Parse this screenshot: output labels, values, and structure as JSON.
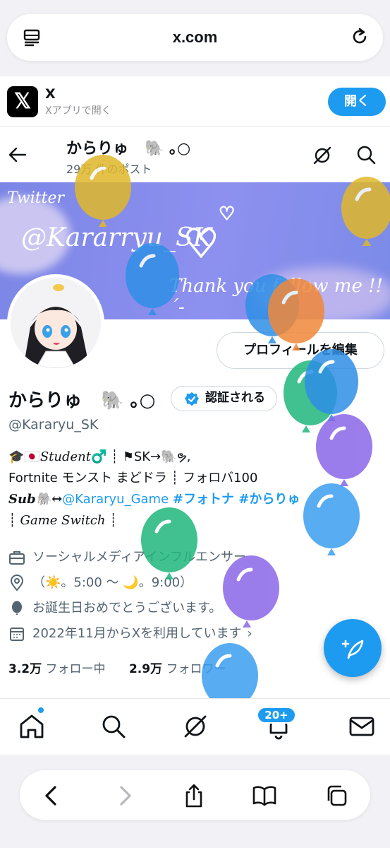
{
  "browser": {
    "url": "x.com"
  },
  "app_banner": {
    "name": "X",
    "subtitle": "Xアプリで開く",
    "open_label": "開く",
    "logo": "𝕏"
  },
  "header": {
    "name": "からりゅ ︎ ︎ 🐘 ｡○",
    "posts_count": "29万 件のポスト"
  },
  "cover": {
    "line1": "Twitter",
    "line2": "@Kararryu_SK",
    "line3": "Thank you follow me !! ´-",
    "bg_color": "#8a8fec"
  },
  "profile": {
    "name": "からりゅ ︎ ︎ 🐘 ｡○",
    "verify_label": "認証される",
    "handle": "@Kararyu_SK",
    "edit_label": "プロフィールを編集",
    "bio_line1_a": "🎓🇯🇵",
    "bio_line1_b": "Student",
    "bio_line1_c": "♂️ ┊ ⚑SK→🐘ຯ,",
    "bio_line2": "Fortnite モンスト まどドラ ┊ フォロバ100",
    "bio_line3_a": "Sub🐘↔",
    "bio_line3_link": "@Kararyu_Game",
    "bio_line3_tags": "#フォトナ #からりゅ",
    "bio_line4": "┊ Game Switch ┊",
    "category": "ソーシャルメディアインフルエンサー",
    "location": "（☀️。5:00 ～ 🌙。9:00）",
    "birthday": "お誕生日おめでとうございます。",
    "joined": "2022年11月からXを利用しています",
    "following_count": "3.2万",
    "following_label": "フォロー中",
    "followers_count": "2.9万",
    "followers_label": "フォロワー"
  },
  "tabbar": {
    "notifications_badge": "20+"
  },
  "colors": {
    "accent": "#1d9bf0",
    "text": "#0f1419",
    "secondary": "#536471"
  }
}
